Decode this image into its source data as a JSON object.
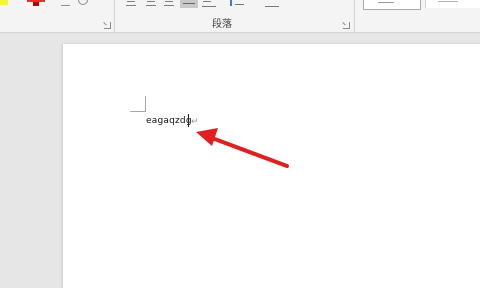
{
  "ribbon": {
    "paragraph_group_label": "段落",
    "icons": {
      "highlight": "text-highlight-color-icon",
      "font_color": "font-color-icon",
      "character_border": "character-border-icon",
      "enclose_characters": "enclose-characters-icon",
      "font_dialog_launcher": "dialog-launcher-icon",
      "align_left": "align-left-icon",
      "align_center": "align-center-icon",
      "align_right": "align-right-icon",
      "justify": "justify-icon",
      "distributed": "distributed-icon",
      "line_spacing": "line-spacing-icon",
      "shading": "shading-icon",
      "paragraph_dialog_launcher": "dialog-launcher-icon"
    },
    "active_alignment": "justify",
    "colors": {
      "highlight": "#f5f04a",
      "font_color": "#e03030"
    }
  },
  "document": {
    "text": "eagaqzdg",
    "paragraph_mark": "↵"
  },
  "annotation": {
    "arrow_color": "#e02020"
  }
}
